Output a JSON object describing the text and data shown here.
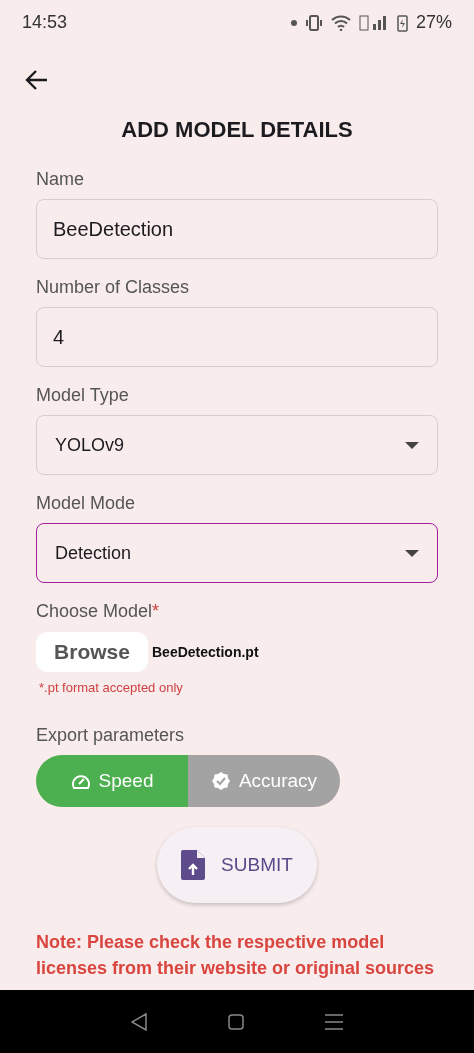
{
  "status_bar": {
    "time": "14:53",
    "battery": "27%"
  },
  "title": "ADD MODEL DETAILS",
  "fields": [
    {
      "label": "Name",
      "kind": "text",
      "value": "BeeDetection",
      "focused": false
    },
    {
      "label": "Number of Classes",
      "kind": "text",
      "value": "4",
      "focused": false
    },
    {
      "label": "Model Type",
      "kind": "dropdown",
      "value": "YOLOv9",
      "focused": false
    },
    {
      "label": "Model Mode",
      "kind": "dropdown",
      "value": "Detection",
      "focused": true
    }
  ],
  "choose_model": {
    "label": "Choose Model",
    "required_mark": "*",
    "button": "Browse",
    "file_name": "BeeDetection.pt",
    "hint": "*.pt format accepted only"
  },
  "export": {
    "label": "Export parameters",
    "options": [
      {
        "label": "Speed",
        "kind": "speed",
        "selected": true
      },
      {
        "label": "Accuracy",
        "kind": "accuracy",
        "selected": false
      }
    ]
  },
  "submit_button": "SUBMIT",
  "note": "Note: Please check the respective model licenses from their website or original sources"
}
